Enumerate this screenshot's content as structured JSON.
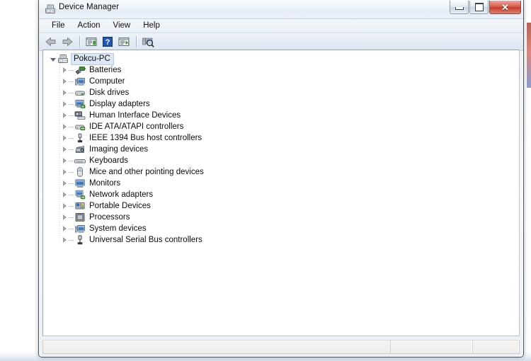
{
  "window": {
    "title": "Device Manager",
    "title_icon": "device-manager-icon",
    "buttons": {
      "minimize": "Minimize",
      "maximize": "Maximize",
      "close": "Close",
      "close_glyph": "✕"
    }
  },
  "menubar": {
    "items": [
      {
        "label": "File",
        "name": "menu-file"
      },
      {
        "label": "Action",
        "name": "menu-action"
      },
      {
        "label": "View",
        "name": "menu-view"
      },
      {
        "label": "Help",
        "name": "menu-help"
      }
    ]
  },
  "toolbar": {
    "buttons": [
      {
        "name": "back-button",
        "icon": "back-arrow-icon",
        "tooltip": "Back"
      },
      {
        "name": "forward-button",
        "icon": "forward-arrow-icon",
        "tooltip": "Forward"
      },
      {
        "name": "properties-button",
        "icon": "properties-icon",
        "tooltip": "Properties"
      },
      {
        "name": "help-button",
        "icon": "question-mark-icon",
        "tooltip": "Help"
      },
      {
        "name": "update-driver-button",
        "icon": "update-driver-icon",
        "tooltip": "Update Driver Software"
      },
      {
        "name": "scan-hardware-button",
        "icon": "scan-hardware-changes-icon",
        "tooltip": "Scan for hardware changes"
      }
    ]
  },
  "tree": {
    "root": {
      "label": "Pokcu-PC",
      "icon": "computer-root-icon",
      "expanded": true,
      "selected": true
    },
    "children": [
      {
        "label": "Batteries",
        "icon": "battery-icon",
        "expanded": false
      },
      {
        "label": "Computer",
        "icon": "computer-icon",
        "expanded": false
      },
      {
        "label": "Disk drives",
        "icon": "disk-drive-icon",
        "expanded": false
      },
      {
        "label": "Display adapters",
        "icon": "display-adapter-icon",
        "expanded": false
      },
      {
        "label": "Human Interface Devices",
        "icon": "hid-icon",
        "expanded": false
      },
      {
        "label": "IDE ATA/ATAPI controllers",
        "icon": "ide-controller-icon",
        "expanded": false
      },
      {
        "label": "IEEE 1394 Bus host controllers",
        "icon": "ieee1394-icon",
        "expanded": false
      },
      {
        "label": "Imaging devices",
        "icon": "imaging-device-icon",
        "expanded": false
      },
      {
        "label": "Keyboards",
        "icon": "keyboard-icon",
        "expanded": false
      },
      {
        "label": "Mice and other pointing devices",
        "icon": "mouse-icon",
        "expanded": false
      },
      {
        "label": "Monitors",
        "icon": "monitor-icon",
        "expanded": false
      },
      {
        "label": "Network adapters",
        "icon": "network-adapter-icon",
        "expanded": false
      },
      {
        "label": "Portable Devices",
        "icon": "portable-device-icon",
        "expanded": false
      },
      {
        "label": "Processors",
        "icon": "processor-icon",
        "expanded": false
      },
      {
        "label": "System devices",
        "icon": "system-device-icon",
        "expanded": false
      },
      {
        "label": "Universal Serial Bus controllers",
        "icon": "usb-controller-icon",
        "expanded": false
      }
    ]
  },
  "statusbar": {
    "cells": [
      "",
      "",
      ""
    ]
  },
  "colors": {
    "accent": "#3a6ea5",
    "close_button": "#c23d2c",
    "selection": "#dce8f5",
    "panel_background": "#ffffff",
    "window_chrome": "#e9eff7"
  }
}
